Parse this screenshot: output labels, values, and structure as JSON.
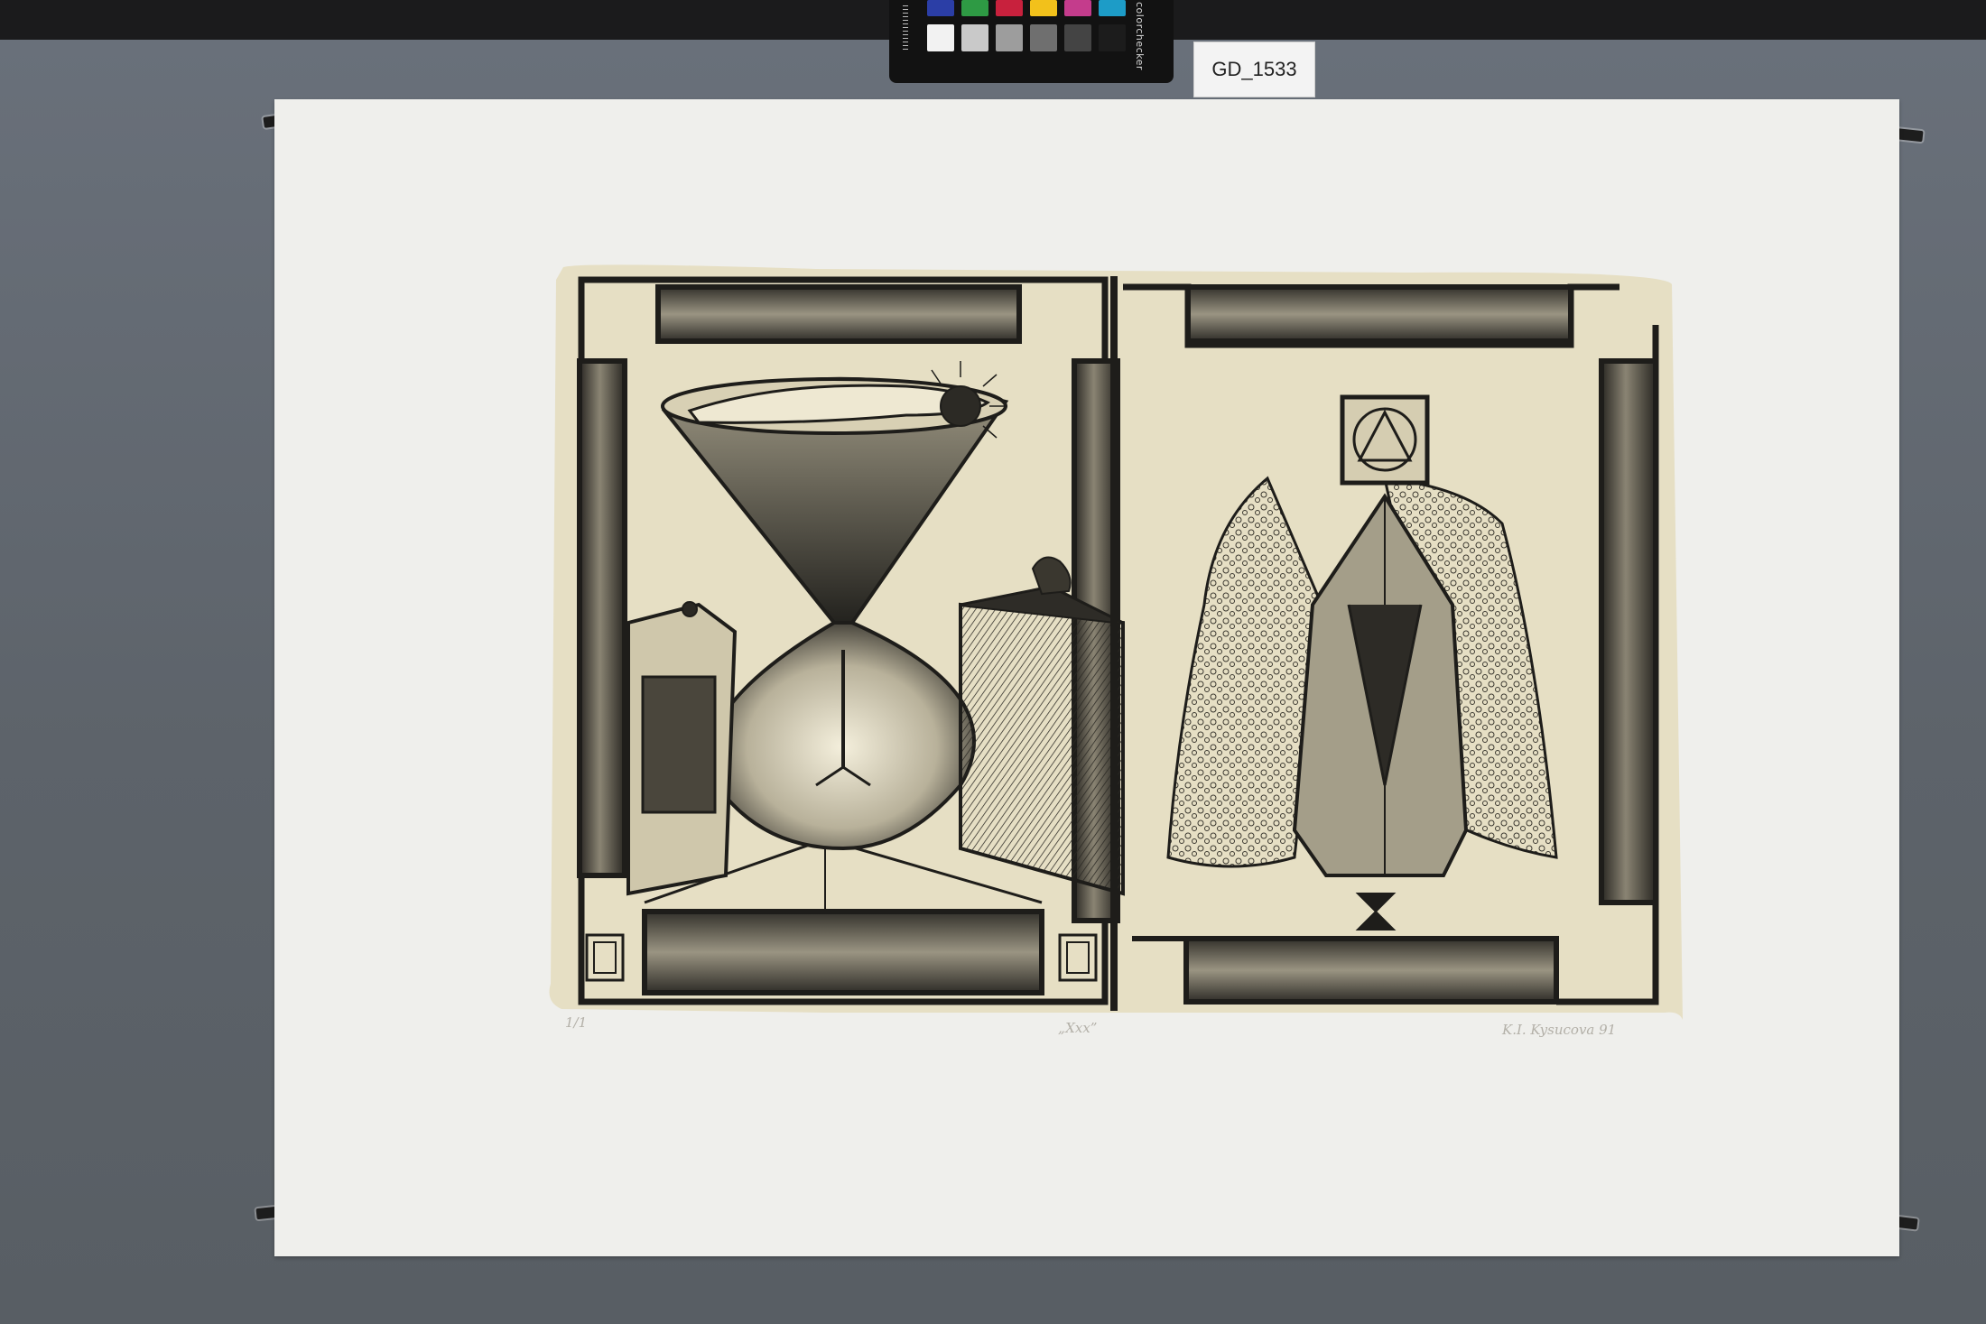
{
  "specimen_label": "GD_1533",
  "colorchecker": {
    "brand_text": "colorchecker",
    "top_row_colors": [
      "#2b3ea6",
      "#2e9a44",
      "#c8213d",
      "#f2c11b",
      "#c43c8c",
      "#1d9cc7"
    ],
    "bottom_row_colors": [
      "#f2f2f2",
      "#c9c9c9",
      "#9d9d9d",
      "#6f6f6f",
      "#444444",
      "#1c1c1c"
    ]
  },
  "colors": {
    "board": "#60666c",
    "paper": "#efefec",
    "print_ground": "#e6dfc4",
    "ink": "#1e1d1a"
  },
  "print": {
    "title_inscription": "„Xxx”",
    "edition_inscription": "1/1",
    "signature": "K.I. Kysucova 91"
  }
}
